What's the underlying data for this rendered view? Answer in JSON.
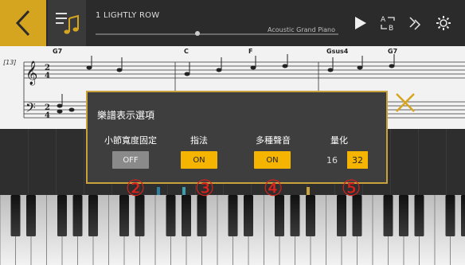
{
  "header": {
    "song_title": "1 LIGHTLY ROW",
    "voice": "Acoustic Grand Piano",
    "progress": 0.42
  },
  "icons": {
    "back": "chevron-left-icon",
    "menu": "music-menu-icon",
    "play": "play-icon",
    "ab_repeat": "ab-repeat-icon",
    "part_select": "part-select-icon",
    "settings": "gear-icon",
    "close": "close-icon"
  },
  "score": {
    "measure_number": "[13]",
    "chords": [
      "G7",
      "C",
      "F",
      "Gsus4",
      "G7"
    ]
  },
  "dialog": {
    "title": "樂譜表示選項",
    "options": [
      {
        "label": "小節寬度固定",
        "value": "OFF",
        "state": "off"
      },
      {
        "label": "指法",
        "value": "ON",
        "state": "on"
      },
      {
        "label": "多種聲音",
        "value": "ON",
        "state": "on"
      }
    ],
    "quantize": {
      "label": "量化",
      "choices": [
        "16",
        "32"
      ],
      "selected": "32"
    }
  },
  "callouts": [
    "②",
    "③",
    "④",
    "⑤"
  ],
  "colors": {
    "accent": "#f5b400",
    "brand_gold": "#d6a520",
    "callout_red": "#e0201a",
    "dialog_bg": "#3e3e3e"
  }
}
